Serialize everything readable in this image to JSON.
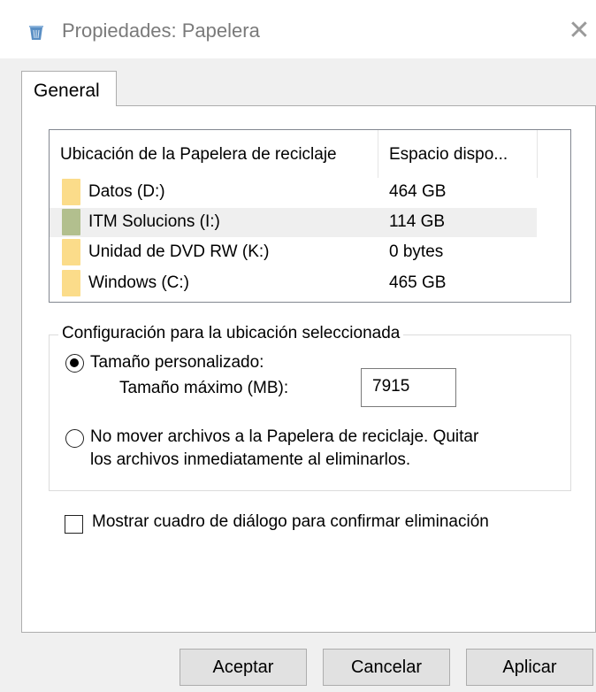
{
  "window": {
    "title": "Propiedades: Papelera",
    "icon": "recycle-bin-icon",
    "close_glyph": "✕"
  },
  "tabs": [
    {
      "label": "General",
      "selected": true
    }
  ],
  "locations": {
    "headers": [
      "Ubicación de la Papelera de reciclaje",
      "Espacio dispo..."
    ],
    "rows": [
      {
        "name": "Datos (D:)",
        "space": "464 GB",
        "icon": "folder-icon"
      },
      {
        "name": "ITM Solucions (I:)",
        "space": "114 GB",
        "icon": "network-drive-icon",
        "selected": true
      },
      {
        "name": "Unidad de DVD RW (K:)",
        "space": "0 bytes",
        "icon": "folder-icon"
      },
      {
        "name": "Windows  (C:)",
        "space": "465 GB",
        "icon": "folder-icon"
      }
    ]
  },
  "settings": {
    "group_label": "Configuración para la ubicación seleccionada",
    "custom_size_label": "Tamaño personalizado:",
    "custom_size_selected": true,
    "max_size_label": "Tamaño máximo (MB):",
    "max_size_value": "7915",
    "no_move_line1": "No mover archivos a la Papelera de reciclaje. Quitar",
    "no_move_line2": "los archivos inmediatamente al eliminarlos.",
    "no_move_selected": false
  },
  "confirm_dialog": {
    "label": "Mostrar cuadro de diálogo para confirmar eliminación",
    "checked": false
  },
  "buttons": {
    "ok": "Aceptar",
    "cancel": "Cancelar",
    "apply": "Aplicar"
  },
  "colors": {
    "folder": "#fbdc8a",
    "network_drive": "#b2bf8e",
    "selection": "#efefef"
  }
}
